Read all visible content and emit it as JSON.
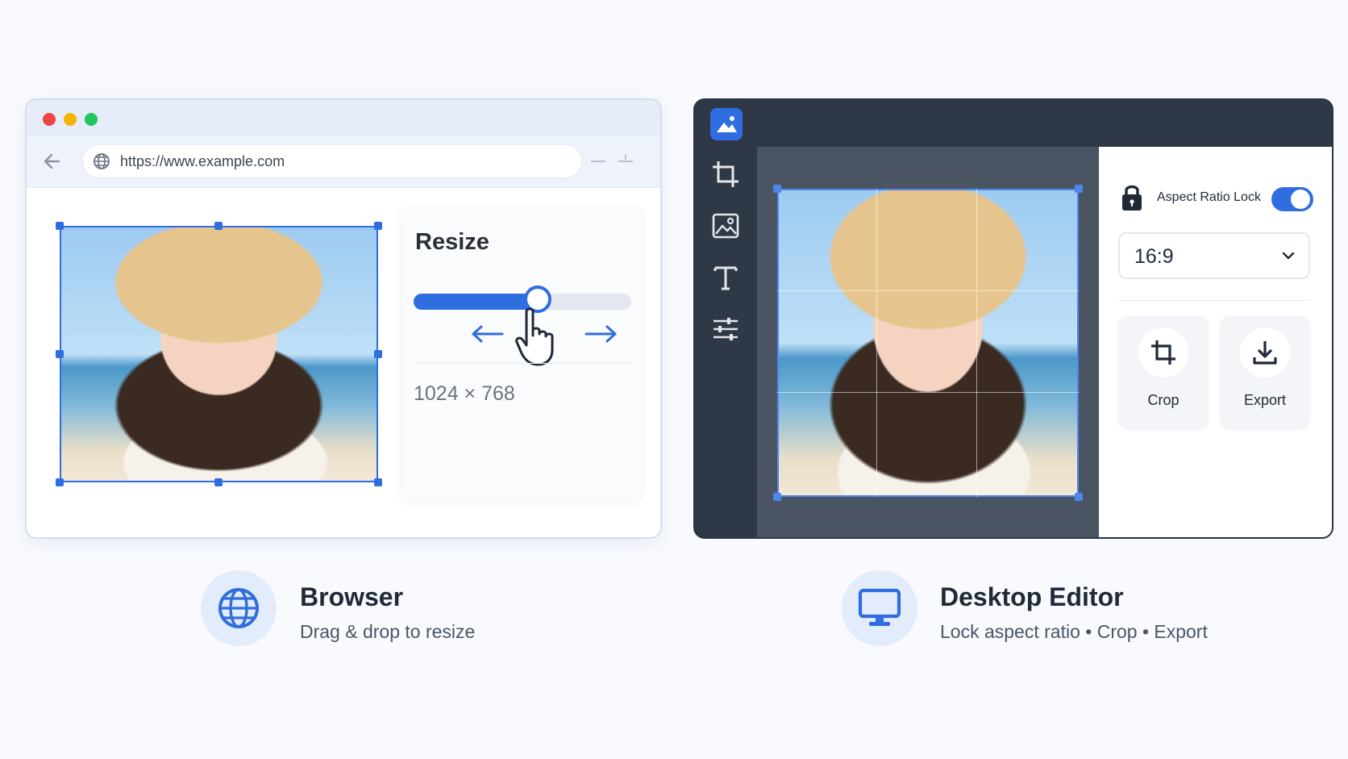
{
  "browser": {
    "url": "https://www.example.com",
    "traffic_lights": [
      "#ef4444",
      "#f5b400",
      "#22c55e"
    ],
    "panel_title": "Resize",
    "slider_level": 0.57,
    "dimensions": "1024 × 768"
  },
  "editor": {
    "tools": [
      "crop-tool-icon",
      "image-tool-icon",
      "text-tool-icon",
      "adjust-tool-icon"
    ],
    "aspect_lock_label": "Aspect Ratio Lock",
    "aspect_lock_on": true,
    "ratio": "16:9",
    "actions": [
      {
        "label": "Crop",
        "icon": "crop-icon"
      },
      {
        "label": "Export",
        "icon": "download-icon"
      }
    ]
  },
  "captions": {
    "browser_title": "Browser",
    "browser_sub": "Drag & drop to resize",
    "desktop_title": "Desktop Editor",
    "desktop_sub": "Lock aspect ratio • Crop • Export"
  },
  "colors": {
    "accent": "#2f6ee0",
    "editor_dark": "#2f3846"
  }
}
